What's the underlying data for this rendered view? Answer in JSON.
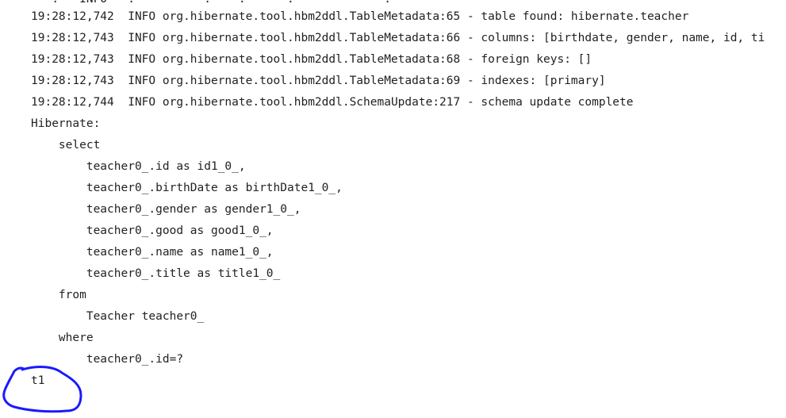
{
  "console": {
    "lines": [
      "19:28:12,742  INFO org.hibernate.tool.hbm2ddl.TableMetadata:65 - table found: hibernate.teacher",
      "19:28:12,743  INFO org.hibernate.tool.hbm2ddl.TableMetadata:66 - columns: [birthdate, gender, name, id, ti",
      "19:28:12,743  INFO org.hibernate.tool.hbm2ddl.TableMetadata:68 - foreign keys: []",
      "19:28:12,743  INFO org.hibernate.tool.hbm2ddl.TableMetadata:69 - indexes: [primary]",
      "19:28:12,744  INFO org.hibernate.tool.hbm2ddl.SchemaUpdate:217 - schema update complete",
      "Hibernate:",
      "    select",
      "        teacher0_.id as id1_0_,",
      "        teacher0_.birthDate as birthDate1_0_,",
      "        teacher0_.gender as gender1_0_,",
      "        teacher0_.good as good1_0_,",
      "        teacher0_.name as name1_0_,",
      "        teacher0_.title as title1_0_",
      "    from",
      "        Teacher teacher0_",
      "    where",
      "        teacher0_.id=?",
      "t1"
    ],
    "annotation_color": "#1a1aff"
  }
}
